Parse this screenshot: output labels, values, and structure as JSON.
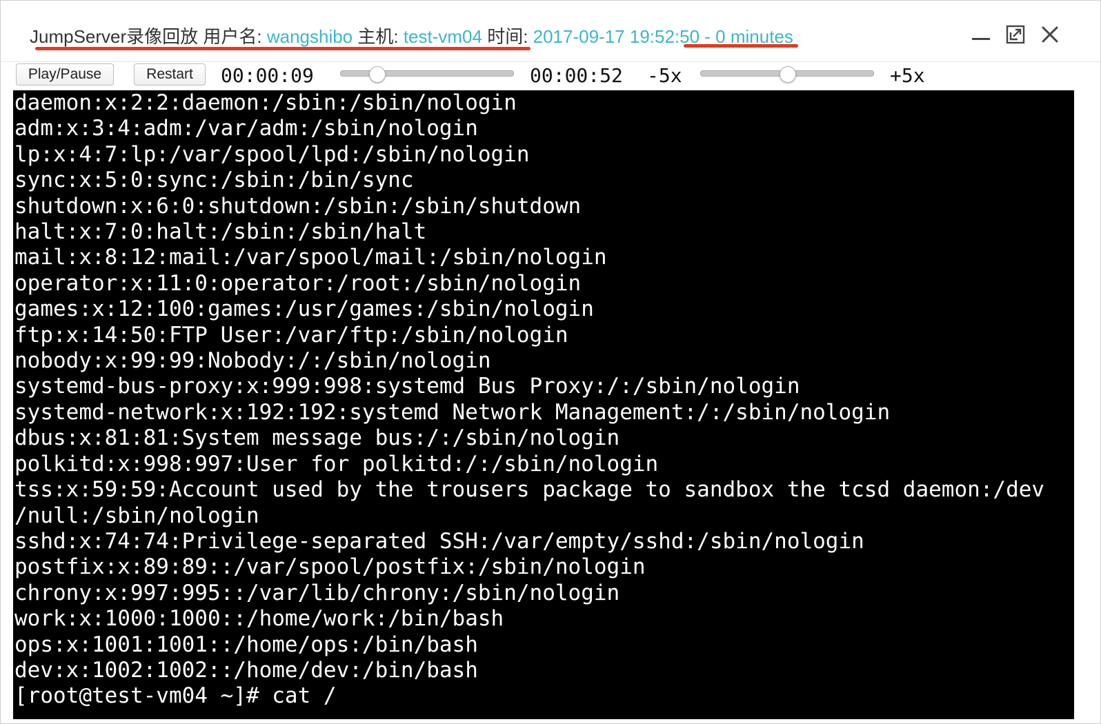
{
  "window": {
    "title_prefix": "JumpServer录像回放 用户名: ",
    "username": "wangshibo",
    "host_label": " 主机: ",
    "host": "test-vm04",
    "time_label": " 时间: ",
    "time_value": "2017-09-17 19:52:50 - 0 minutes",
    "accent_color": "#3cb6c9",
    "underline_color": "#e63a1f"
  },
  "controls": {
    "minimize_icon": "minimize-icon",
    "maximize_icon": "expand-icon",
    "close_icon": "close-icon"
  },
  "player": {
    "play_pause_label": "Play/Pause",
    "restart_label": "Restart",
    "current_time": "00:00:09",
    "total_time": "00:00:52",
    "progress_fraction": 0.21,
    "speed_min_label": "-5x",
    "speed_max_label": "+5x",
    "speed_fraction": 0.5
  },
  "terminal": {
    "lines": [
      "daemon:x:2:2:daemon:/sbin:/sbin/nologin",
      "adm:x:3:4:adm:/var/adm:/sbin/nologin",
      "lp:x:4:7:lp:/var/spool/lpd:/sbin/nologin",
      "sync:x:5:0:sync:/sbin:/bin/sync",
      "shutdown:x:6:0:shutdown:/sbin:/sbin/shutdown",
      "halt:x:7:0:halt:/sbin:/sbin/halt",
      "mail:x:8:12:mail:/var/spool/mail:/sbin/nologin",
      "operator:x:11:0:operator:/root:/sbin/nologin",
      "games:x:12:100:games:/usr/games:/sbin/nologin",
      "ftp:x:14:50:FTP User:/var/ftp:/sbin/nologin",
      "nobody:x:99:99:Nobody:/:/sbin/nologin",
      "systemd-bus-proxy:x:999:998:systemd Bus Proxy:/:/sbin/nologin",
      "systemd-network:x:192:192:systemd Network Management:/:/sbin/nologin",
      "dbus:x:81:81:System message bus:/:/sbin/nologin",
      "polkitd:x:998:997:User for polkitd:/:/sbin/nologin",
      "tss:x:59:59:Account used by the trousers package to sandbox the tcsd daemon:/dev",
      "/null:/sbin/nologin",
      "sshd:x:74:74:Privilege-separated SSH:/var/empty/sshd:/sbin/nologin",
      "postfix:x:89:89::/var/spool/postfix:/sbin/nologin",
      "chrony:x:997:995::/var/lib/chrony:/sbin/nologin",
      "work:x:1000:1000::/home/work:/bin/bash",
      "ops:x:1001:1001::/home/ops:/bin/bash",
      "dev:x:1002:1002::/home/dev:/bin/bash",
      "[root@test-vm04 ~]# cat /"
    ]
  }
}
